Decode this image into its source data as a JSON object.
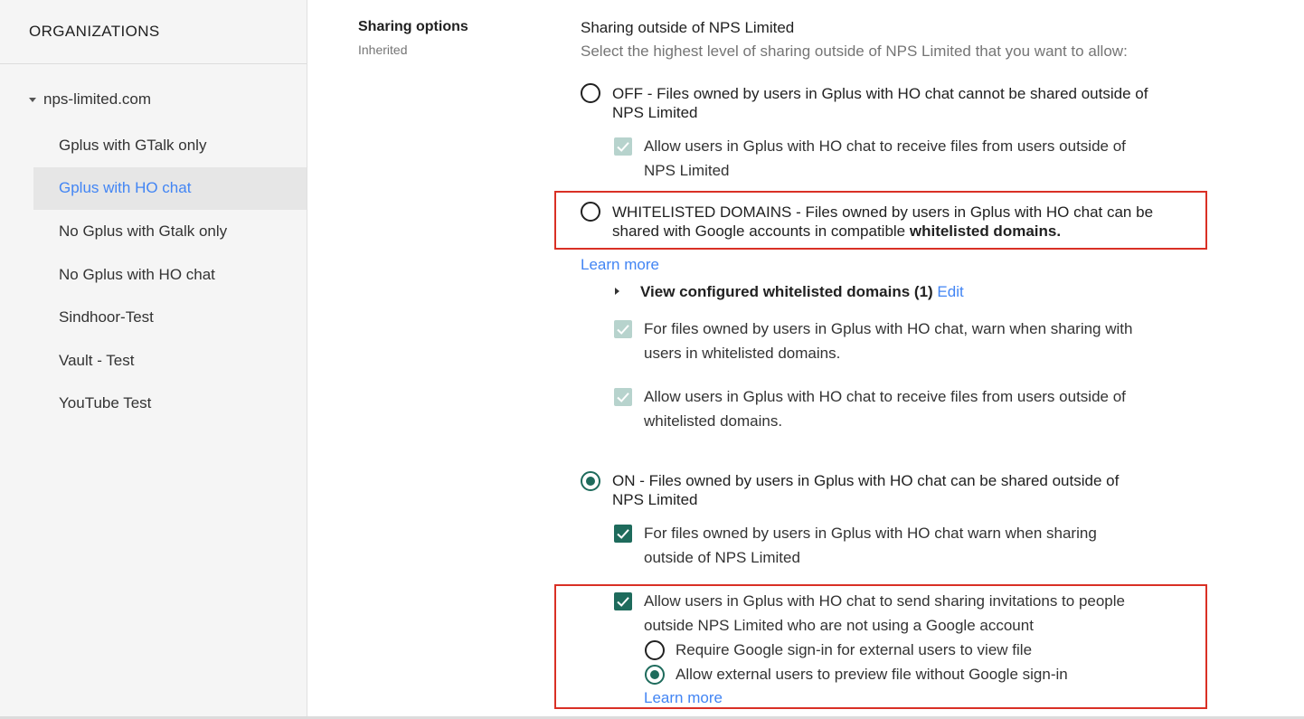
{
  "sidebar": {
    "header": "ORGANIZATIONS",
    "root": "nps-limited.com",
    "items": [
      {
        "label": "Gplus with GTalk only"
      },
      {
        "label": "Gplus with HO chat"
      },
      {
        "label": "No Gplus with Gtalk only"
      },
      {
        "label": "No Gplus with HO chat"
      },
      {
        "label": "Sindhoor-Test"
      },
      {
        "label": "Vault - Test"
      },
      {
        "label": "YouTube Test"
      }
    ]
  },
  "section": {
    "title": "Sharing options",
    "subtitle": "Inherited"
  },
  "main": {
    "heading": "Sharing outside of NPS Limited",
    "subheading": "Select the highest level of sharing outside of NPS Limited that you want to allow:",
    "off": {
      "label_line1": "OFF - Files owned by users in Gplus with HO chat cannot be shared outside of",
      "label_line2": "NPS Limited",
      "receive_line1": "Allow users in Gplus with HO chat to receive files from users outside of",
      "receive_line2": "NPS Limited"
    },
    "whitelisted": {
      "label_line1": "WHITELISTED DOMAINS - Files owned by users in Gplus with HO chat can be",
      "label_line2a": "shared with Google accounts in compatible ",
      "label_line2b": "whitelisted domains.",
      "learn_more": "Learn more",
      "view_domains": "View configured whitelisted domains (1)",
      "edit": "Edit",
      "warn_line1": "For files owned by users in Gplus with HO chat, warn when sharing with",
      "warn_line2": "users in whitelisted domains.",
      "receive_line1": "Allow users in Gplus with HO chat to receive files from users outside of",
      "receive_line2": "whitelisted domains."
    },
    "on": {
      "label_line1": "ON - Files owned by users in Gplus with HO chat can be shared outside of",
      "label_line2": "NPS Limited",
      "warn_line1": "For files owned by users in Gplus with HO chat warn when sharing",
      "warn_line2": "outside of NPS Limited",
      "invite_line1": "Allow users in Gplus with HO chat to send sharing invitations to people",
      "invite_line2": "outside NPS Limited who are not using a Google account",
      "require_signin": "Require Google sign-in for external users to view file",
      "allow_preview": "Allow external users to preview file without Google sign-in",
      "learn_more": "Learn more"
    }
  },
  "colors": {
    "accent": "#1e6b5c",
    "link": "#4285f4",
    "highlight": "#d93025",
    "disabled_check": "#b7d3cd"
  }
}
